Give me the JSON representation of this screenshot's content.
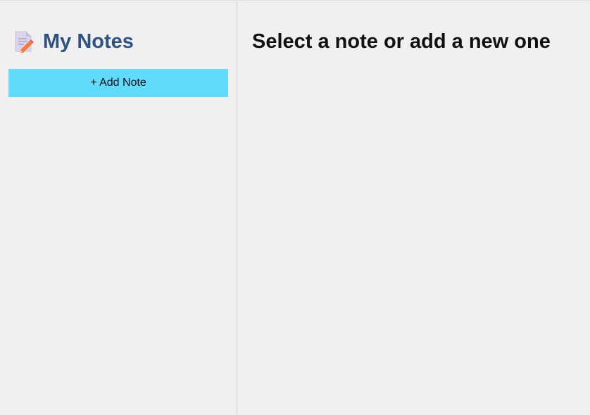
{
  "sidebar": {
    "title": "My Notes",
    "icon": "memo-icon",
    "add_button_label": "+ Add Note"
  },
  "main": {
    "empty_state_heading": "Select a note or add a new one"
  },
  "colors": {
    "title": "#2f5380",
    "add_button": "#61dafb",
    "background": "#f0f0f0"
  }
}
